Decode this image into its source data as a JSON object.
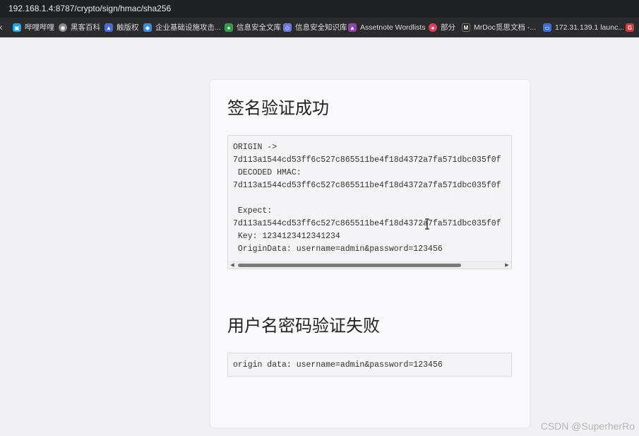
{
  "browser": {
    "url": "192.168.1.4:8787/crypto/sign/hmac/sha256"
  },
  "bookmarks": [
    {
      "label": "k",
      "icon": "",
      "color": "#2b2b2e"
    },
    {
      "label": "哔哩哔哩",
      "icon": "bilibili-icon",
      "color": "#1fa6e0"
    },
    {
      "label": "黑客百科",
      "icon": "globe-icon",
      "color": "#888888"
    },
    {
      "label": "触版权",
      "icon": "app-icon",
      "color": "#4a6cd4"
    },
    {
      "label": "企业基础设施攻击...",
      "icon": "cube-icon",
      "color": "#3a8dde"
    },
    {
      "label": "信息安全文库",
      "icon": "shield-icon",
      "color": "#2e9e4a"
    },
    {
      "label": "信息安全知识库",
      "icon": "diamond-icon",
      "color": "#6c7ae0"
    },
    {
      "label": "Assetnote Wordlists",
      "icon": "triangle-icon",
      "color": "#8e44ad"
    },
    {
      "label": "部分",
      "icon": "badge-icon",
      "color": "#e0405e"
    },
    {
      "label": "MrDoc觅思文档 -...",
      "icon": "doc-icon",
      "color": "#222222"
    },
    {
      "label": "172.31.139.1 launc...",
      "icon": "window-icon",
      "color": "#3b6fd4"
    },
    {
      "label": "",
      "icon": "g-icon",
      "color": "#d33b3b"
    }
  ],
  "section_success": {
    "title": "签名验证成功",
    "lines": [
      "ORIGIN ->",
      "7d113a1544cd53ff6c527c865511be4f18d4372a7fa571dbc035f0f",
      " DECODED HMAC:",
      "7d113a1544cd53ff6c527c865511be4f18d4372a7fa571dbc035f0f",
      "",
      " Expect:",
      "7d113a1544cd53ff6c527c865511be4f18d4372a7fa571dbc035f0f",
      " Key: 1234123412341234",
      " OriginData: username=admin&password=123456"
    ]
  },
  "section_fail": {
    "title": "用户名密码验证失败",
    "line": "origin data: username=admin&password=123456"
  },
  "watermark": "CSDN @SuperherRo"
}
